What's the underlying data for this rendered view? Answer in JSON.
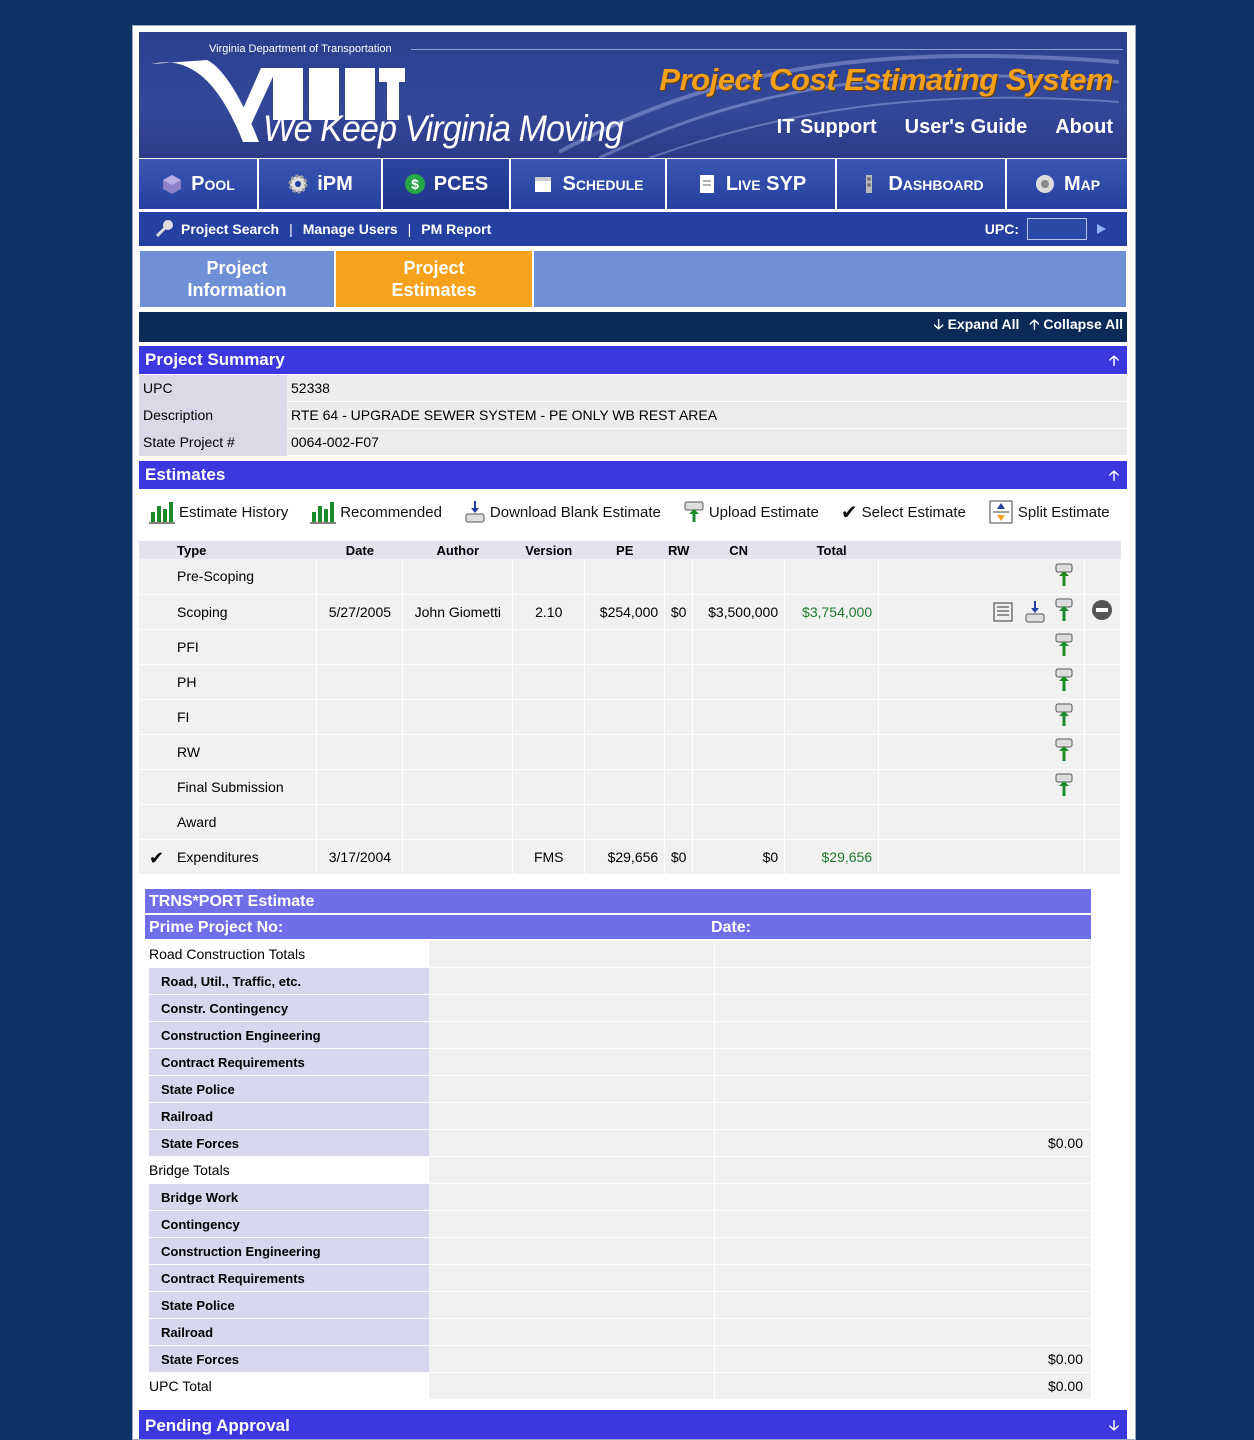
{
  "banner": {
    "org": "Virginia Department of Transportation",
    "slogan": "We Keep Virginia Moving",
    "system_title": "Project Cost Estimating System",
    "links": [
      "IT Support",
      "User's Guide",
      "About"
    ]
  },
  "tabs": [
    {
      "label": "Pool",
      "icon": "cube-icon"
    },
    {
      "label": "iPM",
      "icon": "gear-icon"
    },
    {
      "label": "PCES",
      "icon": "dollar-icon"
    },
    {
      "label": "Schedule",
      "icon": "calendar-icon"
    },
    {
      "label": "Live SYP",
      "icon": "document-icon"
    },
    {
      "label": "Dashboard",
      "icon": "gauge-icon"
    },
    {
      "label": "Map",
      "icon": "globe-icon"
    }
  ],
  "subnav": {
    "items": [
      "Project Search",
      "Manage Users",
      "PM Report"
    ],
    "separator": "|",
    "upc_label": "UPC:"
  },
  "project_tabs": [
    "Project Information",
    "Project Estimates"
  ],
  "expand": {
    "expand_all": "Expand All",
    "collapse_all": "Collapse All"
  },
  "summary": {
    "title": "Project Summary",
    "rows": [
      {
        "label": "UPC",
        "value": "52338"
      },
      {
        "label": "Description",
        "value": "RTE 64 - UPGRADE SEWER SYSTEM - PE ONLY WB REST AREA"
      },
      {
        "label": "State Project #",
        "value": "0064-002-F07"
      }
    ]
  },
  "estimates": {
    "title": "Estimates",
    "toolbar": [
      "Estimate History",
      "Recommended",
      "Download Blank Estimate",
      "Upload Estimate",
      "Select Estimate",
      "Split Estimate"
    ],
    "columns": [
      "Type",
      "Date",
      "Author",
      "Version",
      "PE",
      "RW",
      "CN",
      "Total"
    ],
    "rows": [
      {
        "type": "Pre-Scoping",
        "date": "",
        "author": "",
        "version": "",
        "pe": "",
        "rw": "",
        "cn": "",
        "total": "",
        "upload": true,
        "checked": false
      },
      {
        "type": "Scoping",
        "date": "5/27/2005",
        "author": "John Giometti",
        "version": "2.10",
        "pe": "$254,000",
        "rw": "$0",
        "cn": "$3,500,000",
        "total": "$3,754,000",
        "upload": true,
        "checked": false,
        "extra_icons": true
      },
      {
        "type": "PFI",
        "date": "",
        "author": "",
        "version": "",
        "pe": "",
        "rw": "",
        "cn": "",
        "total": "",
        "upload": true,
        "checked": false
      },
      {
        "type": "PH",
        "date": "",
        "author": "",
        "version": "",
        "pe": "",
        "rw": "",
        "cn": "",
        "total": "",
        "upload": true,
        "checked": false
      },
      {
        "type": "FI",
        "date": "",
        "author": "",
        "version": "",
        "pe": "",
        "rw": "",
        "cn": "",
        "total": "",
        "upload": true,
        "checked": false
      },
      {
        "type": "RW",
        "date": "",
        "author": "",
        "version": "",
        "pe": "",
        "rw": "",
        "cn": "",
        "total": "",
        "upload": true,
        "checked": false
      },
      {
        "type": "Final Submission",
        "date": "",
        "author": "",
        "version": "",
        "pe": "",
        "rw": "",
        "cn": "",
        "total": "",
        "upload": true,
        "checked": false
      },
      {
        "type": "Award",
        "date": "",
        "author": "",
        "version": "",
        "pe": "",
        "rw": "",
        "cn": "",
        "total": "",
        "upload": false,
        "checked": false
      },
      {
        "type": "Expenditures",
        "date": "3/17/2004",
        "author": "",
        "version": "FMS",
        "pe": "$29,656",
        "rw": "$0",
        "cn": "$0",
        "total": "$29,656",
        "upload": false,
        "checked": true
      }
    ]
  },
  "trns": {
    "title": "TRNS*PORT Estimate",
    "prime_label": "Prime Project No:",
    "date_label": "Date:",
    "lines": [
      {
        "label": "Road Construction Totals",
        "sub": false,
        "value": ""
      },
      {
        "label": "Road, Util., Traffic, etc.",
        "sub": true,
        "value": ""
      },
      {
        "label": "Constr. Contingency",
        "sub": true,
        "value": ""
      },
      {
        "label": "Construction Engineering",
        "sub": true,
        "value": ""
      },
      {
        "label": "Contract Requirements",
        "sub": true,
        "value": ""
      },
      {
        "label": "State Police",
        "sub": true,
        "value": ""
      },
      {
        "label": "Railroad",
        "sub": true,
        "value": ""
      },
      {
        "label": "State Forces",
        "sub": true,
        "value": "$0.00"
      },
      {
        "label": "Bridge Totals",
        "sub": false,
        "value": ""
      },
      {
        "label": "Bridge Work",
        "sub": true,
        "value": ""
      },
      {
        "label": "Contingency",
        "sub": true,
        "value": ""
      },
      {
        "label": "Construction Engineering",
        "sub": true,
        "value": ""
      },
      {
        "label": "Contract Requirements",
        "sub": true,
        "value": ""
      },
      {
        "label": "State Police",
        "sub": true,
        "value": ""
      },
      {
        "label": "Railroad",
        "sub": true,
        "value": ""
      },
      {
        "label": "State Forces",
        "sub": true,
        "value": "$0.00"
      },
      {
        "label": "UPC Total",
        "sub": false,
        "value": "$0.00"
      }
    ]
  },
  "pending": {
    "title": "Pending Approval"
  },
  "colors": {
    "page_bg": "#0c3566",
    "section_blue": "#3b38e0",
    "active_tab": "#f7a21d",
    "total_green": "#1d7a2a"
  }
}
